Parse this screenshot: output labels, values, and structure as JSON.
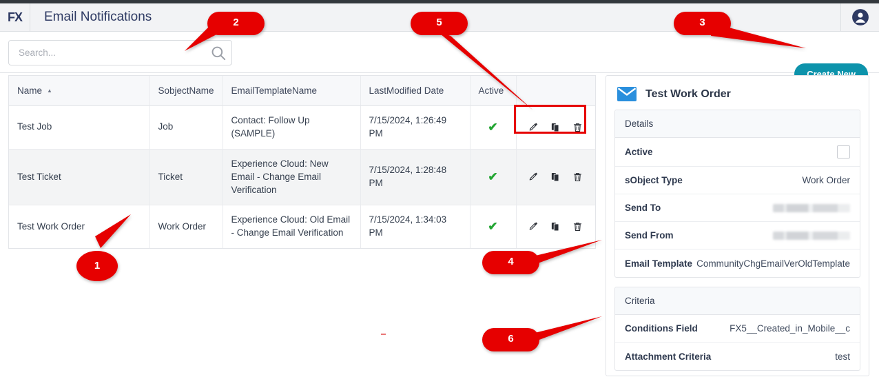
{
  "header": {
    "logo_text": "FX",
    "logo_icon": "fx-logo",
    "title": "Email Notifications",
    "avatar_icon": "user-account-icon"
  },
  "toolbar": {
    "search_placeholder": "Search...",
    "search_value": "",
    "search_icon": "search-icon",
    "create_label": "Create New"
  },
  "table": {
    "columns": [
      {
        "label": "Name",
        "sort": "asc",
        "sort_glyph": "▲"
      },
      {
        "label": "SobjectName"
      },
      {
        "label": "EmailTemplateName"
      },
      {
        "label": "LastModified Date"
      },
      {
        "label": "Active"
      },
      {
        "label": ""
      }
    ],
    "rows": [
      {
        "name": "Test Job",
        "sobject": "Job",
        "template": "Contact: Follow Up (SAMPLE)",
        "modified": "7/15/2024, 1:26:49 PM",
        "active": "✔",
        "actions": [
          "edit-icon",
          "clone-icon",
          "delete-icon"
        ]
      },
      {
        "name": "Test Ticket",
        "sobject": "Ticket",
        "template": "Experience Cloud: New Email - Change Email Verification",
        "modified": "7/15/2024, 1:28:48 PM",
        "active": "✔",
        "actions": [
          "edit-icon",
          "clone-icon",
          "delete-icon"
        ]
      },
      {
        "name": "Test Work Order",
        "sobject": "Work Order",
        "template": "Experience Cloud: Old Email - Change Email Verification",
        "modified": "7/15/2024, 1:34:03 PM",
        "active": "✔",
        "actions": [
          "edit-icon",
          "clone-icon",
          "delete-icon"
        ]
      }
    ]
  },
  "detail": {
    "icon": "envelope-icon",
    "title": "Test Work Order",
    "sections": [
      {
        "heading": "Details",
        "fields": [
          {
            "label": "Active",
            "value": "",
            "type": "checkbox",
            "checked": false
          },
          {
            "label": "sObject Type",
            "value": "Work Order",
            "type": "text"
          },
          {
            "label": "Send To",
            "value": "",
            "type": "redacted"
          },
          {
            "label": "Send From",
            "value": "",
            "type": "redacted"
          },
          {
            "label": "Email Template",
            "value": "CommunityChgEmailVerOldTemplate",
            "type": "text"
          }
        ]
      },
      {
        "heading": "Criteria",
        "fields": [
          {
            "label": "Conditions Field",
            "value": "FX5__Created_in_Mobile__c",
            "type": "text"
          },
          {
            "label": "Attachment Criteria",
            "value": "test",
            "type": "text"
          }
        ]
      }
    ]
  },
  "callouts": [
    {
      "number": "1"
    },
    {
      "number": "2"
    },
    {
      "number": "3"
    },
    {
      "number": "4"
    },
    {
      "number": "5"
    },
    {
      "number": "6"
    }
  ],
  "colors": {
    "callout_red": "#e60000",
    "create_button": "#0d93ab",
    "active_check": "#22a532",
    "envelope_blue": "#2a8fdd",
    "logo_navy": "#2e3a63"
  }
}
